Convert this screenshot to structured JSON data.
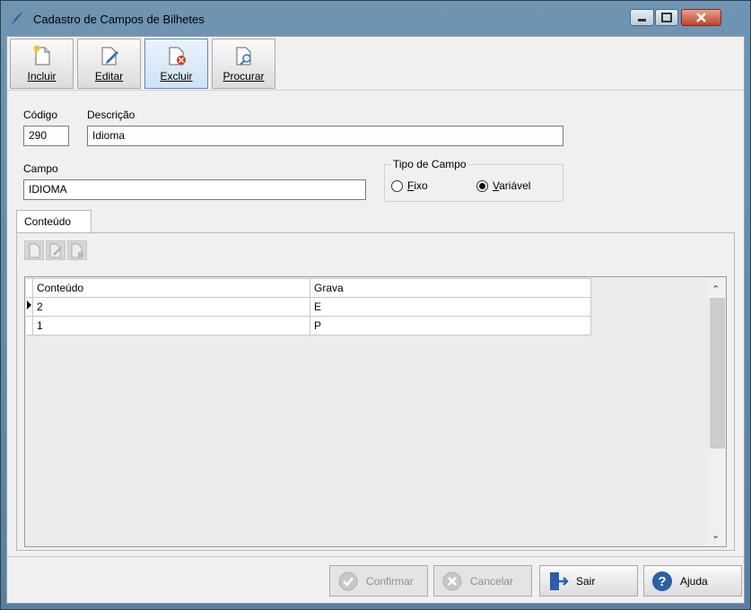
{
  "window": {
    "title": "Cadastro de Campos de Bilhetes"
  },
  "toolbar": {
    "incluir": "Incluir",
    "editar": "Editar",
    "excluir": "Excluir",
    "procurar": "Procurar"
  },
  "form": {
    "codigo_label": "Código",
    "codigo_value": "290",
    "descricao_label": "Descrição",
    "descricao_value": "Idioma",
    "campo_label": "Campo",
    "campo_value": "IDIOMA",
    "tipo_label": "Tipo de Campo",
    "fixo_label": "Fixo",
    "variavel_label": "Variável",
    "selected_tipo": "Variável"
  },
  "tab": {
    "label": "Conteúdo"
  },
  "grid": {
    "headers": [
      "Conteúdo",
      "Grava"
    ],
    "rows": [
      [
        "2",
        "E"
      ],
      [
        "1",
        "P"
      ]
    ]
  },
  "footer": {
    "confirmar": "Confirmar",
    "cancelar": "Cancelar",
    "sair": "Sair",
    "ajuda": "Ajuda"
  },
  "colors": {
    "accent": "#2b5fa8",
    "close": "#c0442a"
  }
}
